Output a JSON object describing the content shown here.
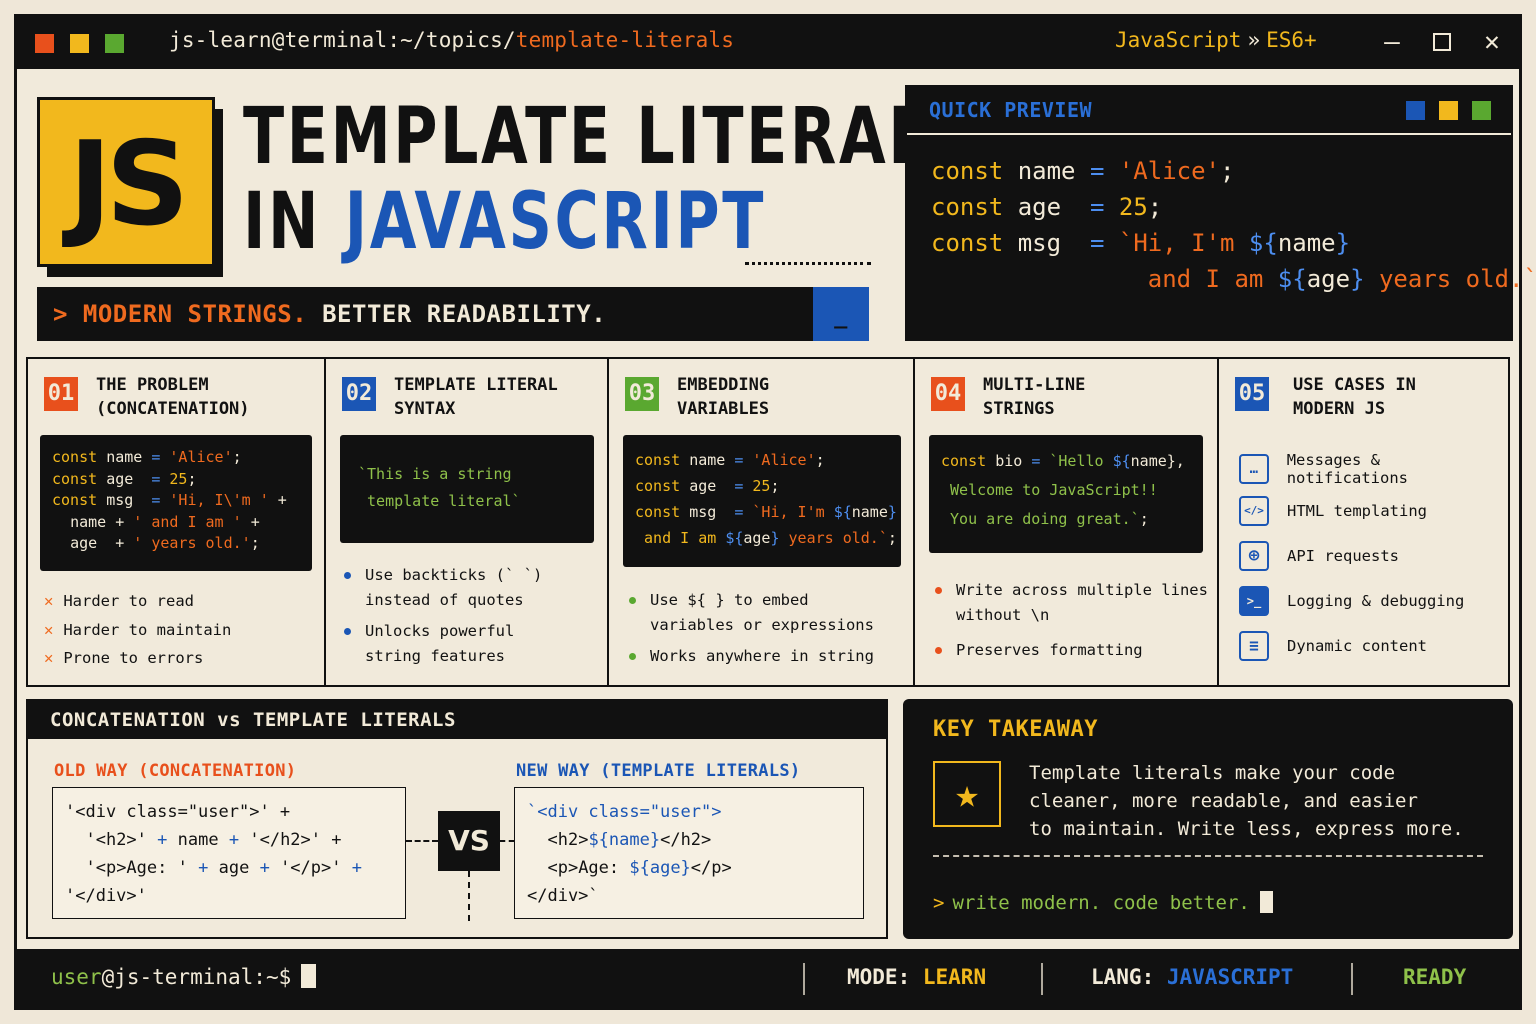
{
  "window": {
    "path_prefix": "js-learn@terminal:~/topics/",
    "path_current": "template-literals",
    "crumb_lang": "JavaScript",
    "crumb_sep": "»",
    "crumb_version": "ES6+",
    "dot_colors": [
      "#e8501c",
      "#f2b81d",
      "#5aa830"
    ]
  },
  "hero": {
    "logo": "JS",
    "title_line1": "TEMPLATE LITERALS",
    "title_line2_prefix": "IN ",
    "title_line2_highlight": "JAVASCRIPT",
    "tagline_prompt": ">",
    "tagline_orange": "MODERN STRINGS.",
    "tagline_rest": "BETTER READABILITY.",
    "tagline_cursor": "_"
  },
  "preview": {
    "title": "QUICK PREVIEW",
    "dot_colors": [
      "#1b56b5",
      "#f2b81d",
      "#5aa830"
    ],
    "lines": {
      "l1": {
        "kw": "const",
        "name": "name",
        "op": "=",
        "val": "'Alice'",
        "end": ";"
      },
      "l2": {
        "kw": "const",
        "name": "age",
        "op": "=",
        "val": "25",
        "end": ";"
      },
      "l3": {
        "kw": "const",
        "name": "msg",
        "op": "=",
        "t1": "`Hi, I'm ",
        "e1_open": "${",
        "e1_var": "name",
        "e1_close": "}"
      },
      "l4": {
        "t2": "and I am ",
        "e2_open": "${",
        "e2_var": "age",
        "e2_close": "}",
        "t3": " years old.`",
        "end": ";"
      }
    }
  },
  "cards": [
    {
      "num": "01",
      "color": "#e8501c",
      "title": "THE PROBLEM\n(CONCATENATION)",
      "bullets": [
        "Harder to read",
        "Harder to maintain",
        "Prone to errors"
      ]
    },
    {
      "num": "02",
      "color": "#1b56b5",
      "title": "TEMPLATE LITERAL\nSYNTAX",
      "code": "`This is a string\n template literal`",
      "bullets": [
        "Use backticks (` `)\ninstead of quotes",
        "Unlocks powerful\nstring features"
      ]
    },
    {
      "num": "03",
      "color": "#5aa830",
      "title": "EMBEDDING\nVARIABLES",
      "bullets": [
        "Use ${ } to embed\nvariables or expressions",
        "Works anywhere in string"
      ]
    },
    {
      "num": "04",
      "color": "#e8501c",
      "title": "MULTI-LINE\nSTRINGS",
      "bullets": [
        "Write across multiple lines\nwithout \\n",
        "Preserves formatting"
      ]
    },
    {
      "num": "05",
      "color": "#1b56b5",
      "title": "USE CASES IN\nMODERN JS",
      "use_cases": [
        {
          "icon": "chat-bubble-icon",
          "glyph": "…",
          "label": "Messages & notifications"
        },
        {
          "icon": "code-tag-icon",
          "glyph": "</>",
          "label": "HTML templating"
        },
        {
          "icon": "globe-icon",
          "glyph": "⊕",
          "label": "API requests"
        },
        {
          "icon": "terminal-icon",
          "glyph": ">_",
          "label": "Logging & debugging"
        },
        {
          "icon": "document-icon",
          "glyph": "≡",
          "label": "Dynamic content"
        }
      ]
    }
  ],
  "card1_code": {
    "l1": {
      "kw": "const",
      "name": "name",
      "op": "=",
      "val": "'Alice'",
      "end": ";"
    },
    "l2": {
      "kw": "const",
      "name": "age",
      "op": "=",
      "val": "25",
      "end": ";"
    },
    "l3": {
      "kw": "const",
      "name": "msg",
      "op": "=",
      "val": "'Hi, I\\'m '",
      "plus": "+"
    },
    "l4": {
      "var": "name",
      "plus": "+",
      "val": "' and I am '",
      "plus2": "+"
    },
    "l5": {
      "var": "age",
      "plus": "+",
      "val": "' years old.'",
      "end": ";"
    }
  },
  "card3_code": {
    "l1": {
      "kw": "const",
      "name": "name",
      "op": "=",
      "val": "'Alice'",
      "end": ";"
    },
    "l2": {
      "kw": "const",
      "name": "age",
      "op": "=",
      "val": "25",
      "end": ";"
    },
    "l3": {
      "kw": "const",
      "name": "msg",
      "op": "=",
      "t1": "`Hi, I'm ",
      "e1": "${",
      "v1": "name",
      "c1": "}"
    },
    "l4": {
      "t2": "and I am ",
      "e2": "${",
      "v2": "age",
      "c2": "}",
      "t3": " years old.`",
      "end": ";"
    }
  },
  "card4_code": {
    "l1": {
      "kw": "const",
      "name": "bio",
      "op": "=",
      "t1": "`Hello ",
      "e1": "${",
      "v1": "name",
      "c1": "},"
    },
    "l2": "Welcome to JavaScript!!",
    "l3": "You are doing great.`",
    "l3_end": ";"
  },
  "compare": {
    "title": "CONCATENATION vs TEMPLATE LITERALS",
    "old_label": "OLD WAY (CONCATENATION)",
    "new_label": "NEW WAY (TEMPLATE LITERALS)",
    "vs": "VS",
    "old_code": {
      "l1": "'<div class=\"user\">' +",
      "l2a": "'<h2>'",
      "l2b": "+",
      "l2c": "name",
      "l2d": "+",
      "l2e": "'</h2>' +",
      "l3a": "'<p>Age: '",
      "l3b": "+",
      "l3c": "age",
      "l3d": "+",
      "l3e": "'</p>'",
      "l3f": "+",
      "l4": "'</div>'"
    },
    "new_code": {
      "l1": "`<div class=\"user\">",
      "l2a": "<h2>",
      "l2b": "${name}",
      "l2c": "</h2>",
      "l3a": "<p>Age: ",
      "l3b": "${age}",
      "l3c": "</p>",
      "l4": "</div>`"
    }
  },
  "takeaway": {
    "title": "KEY TAKEAWAY",
    "text": "Template literals make your code\ncleaner, more readable, and easier\nto maintain. Write less, express more.",
    "prompt": ">",
    "command": "write modern. code better."
  },
  "statusbar": {
    "user": "user",
    "host": "@js-terminal:~$",
    "mode_label": "MODE:",
    "mode_value": "LEARN",
    "lang_label": "LANG:",
    "lang_value": "JAVASCRIPT",
    "status": "READY"
  }
}
